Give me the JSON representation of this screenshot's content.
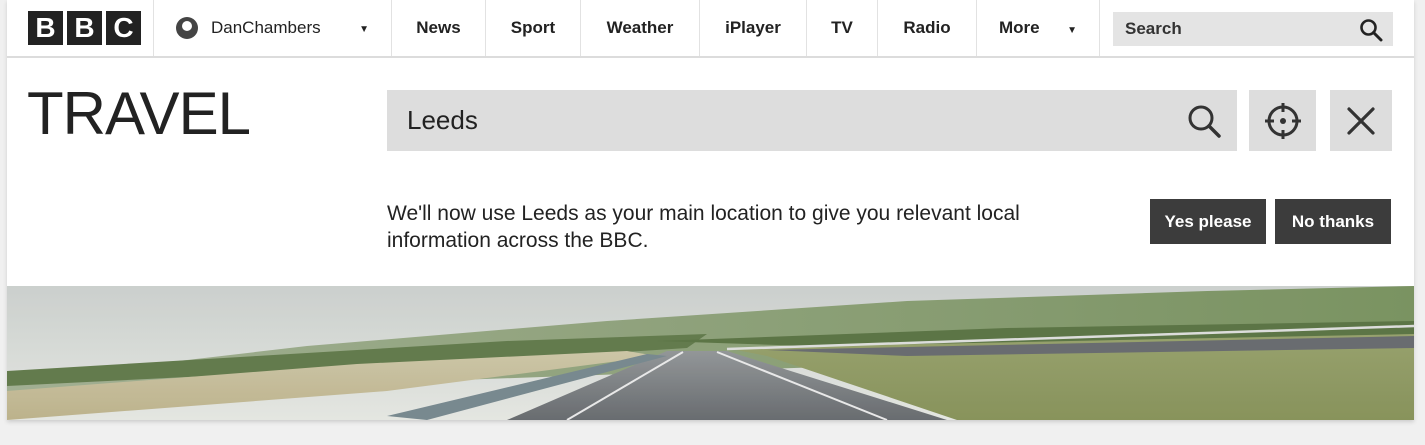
{
  "nav": {
    "logo_letters": [
      "B",
      "B",
      "C"
    ],
    "username": "DanChambers",
    "items": [
      "News",
      "Sport",
      "Weather",
      "iPlayer",
      "TV",
      "Radio"
    ],
    "more_label": "More",
    "search_placeholder": "Search"
  },
  "travel": {
    "title": "TRAVEL",
    "location_value": "Leeds",
    "message": "We'll now use Leeds as your main location to give you relevant local information across the BBC.",
    "yes_label": "Yes please",
    "no_label": "No thanks"
  },
  "icons": {
    "search": "search-icon",
    "locate": "crosshair-icon",
    "close": "close-icon",
    "user": "user-icon",
    "caret": "caret-down-icon"
  },
  "colors": {
    "dark_button": "#3c3c3c",
    "input_bg": "#dddddd",
    "text": "#222222"
  }
}
